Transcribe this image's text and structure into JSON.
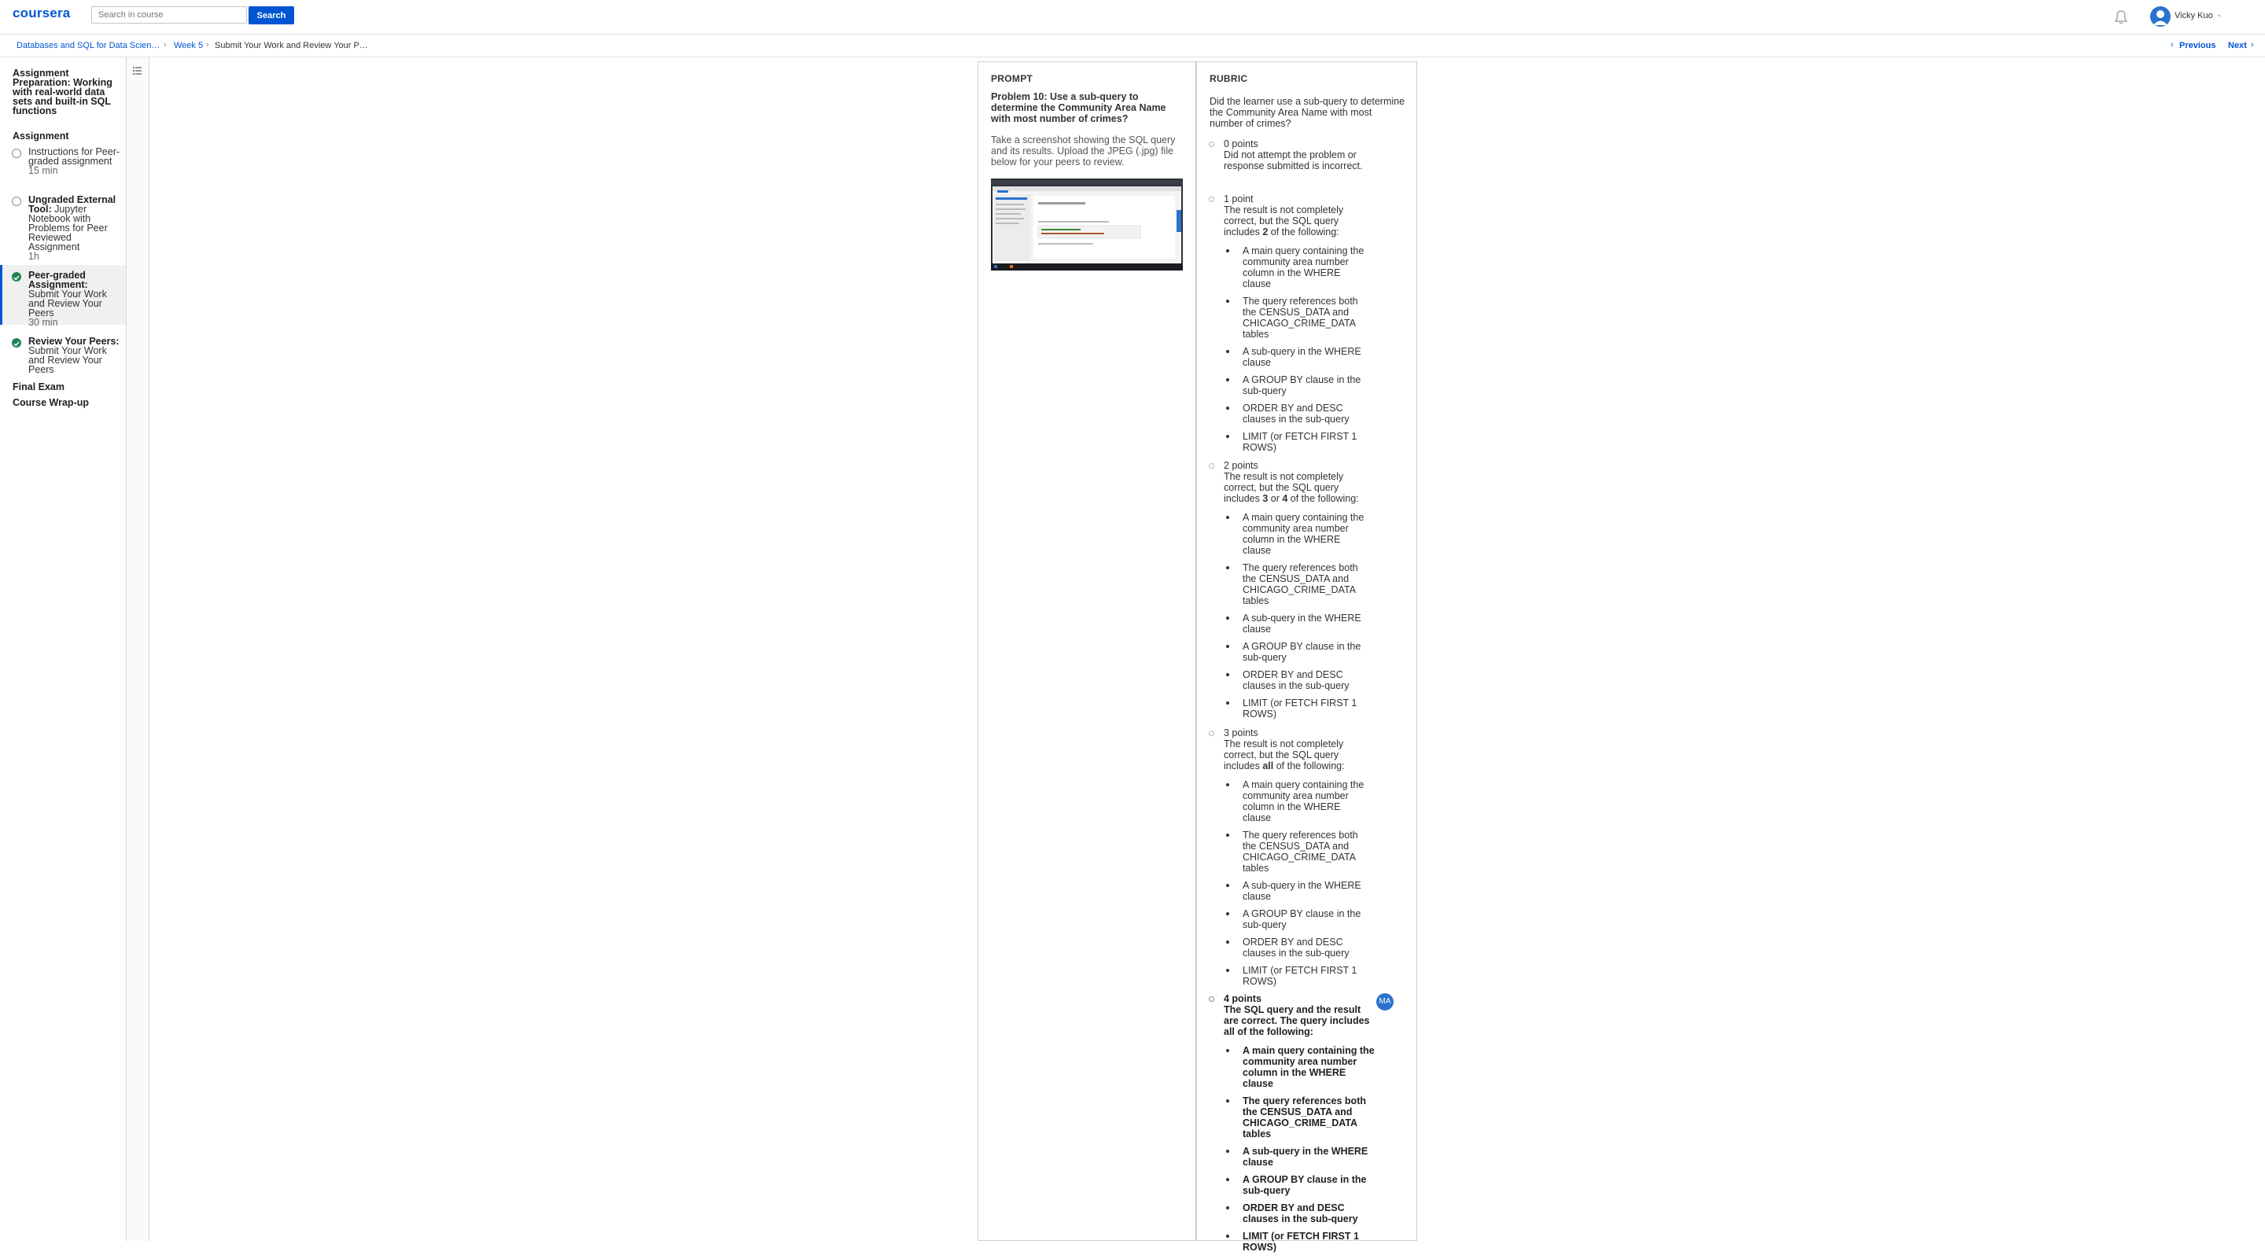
{
  "header": {
    "logo": "coursera",
    "search_placeholder": "Search in course",
    "search_button": "Search",
    "user_name": "Vicky Kuo"
  },
  "breadcrumb": {
    "items": [
      "Databases and SQL for Data Scien…",
      "Week 5",
      "Submit Your Work and Review Your P…"
    ],
    "previous": "Previous",
    "next": "Next"
  },
  "sidebar": {
    "heading": "Assignment Preparation: Working with real-world data sets and built-in SQL functions",
    "section": "Assignment",
    "items": [
      {
        "type_label": "",
        "title": "Instructions for Peer-graded assignment",
        "duration": "15 min",
        "status": "not-started"
      },
      {
        "type_label": "Ungraded External Tool:",
        "title": "Jupyter Notebook with Problems for Peer Reviewed Assignment",
        "duration": "1h",
        "status": "not-started"
      },
      {
        "type_label": "Peer-graded Assignment:",
        "title": "Submit Your Work and Review Your Peers",
        "duration": "30 min",
        "status": "done"
      },
      {
        "type_label": "Review Your Peers:",
        "title": "Submit Your Work and Review Your Peers",
        "duration": "",
        "status": "done"
      }
    ],
    "final_exam": "Final Exam",
    "wrapup": "Course Wrap-up"
  },
  "prompt": {
    "label": "PROMPT",
    "title": "Problem 10: Use a sub-query to determine the Community Area Name with most number of crimes?",
    "body": "Take a screenshot showing the SQL query and its results. Upload the JPEG (.jpg) file below for your peers to review."
  },
  "rubric": {
    "label": "RUBRIC",
    "question": "Did the learner use a sub-query to determine the Community Area Name with most number of crimes?",
    "options": [
      {
        "points": "0 points",
        "text": "Did not attempt the problem or response submitted is incorrect."
      },
      {
        "points": "1 point",
        "text_pre": "The result is not completely correct, but the SQL query includes ",
        "emph": "2",
        "text_post": " of the following:"
      },
      {
        "points": "2 points",
        "text_pre": "The result is not completely correct, but the SQL query includes ",
        "emph": "3",
        "text_mid": " or ",
        "emph2": "4",
        "text_post": " of the following:"
      },
      {
        "points": "3 points",
        "text_pre": "The result is not completely correct, but the SQL query includes ",
        "emph": "all",
        "text_post": " of the following:"
      },
      {
        "points": "4 points",
        "text": "The SQL query and the result are correct. The query includes all of the following:",
        "reviewer": "MA"
      }
    ],
    "criteria": [
      "A main query containing the community area number column in the WHERE clause",
      "The query references both the CENSUS_DATA and CHICAGO_CRIME_DATA tables",
      "A sub-query in the WHERE clause",
      "A GROUP BY clause in the sub-query",
      "ORDER BY and DESC clauses in the sub-query",
      "LIMIT (or FETCH FIRST 1 ROWS)"
    ]
  },
  "colors": {
    "accent": "#0056d2",
    "done": "#1f8354"
  }
}
